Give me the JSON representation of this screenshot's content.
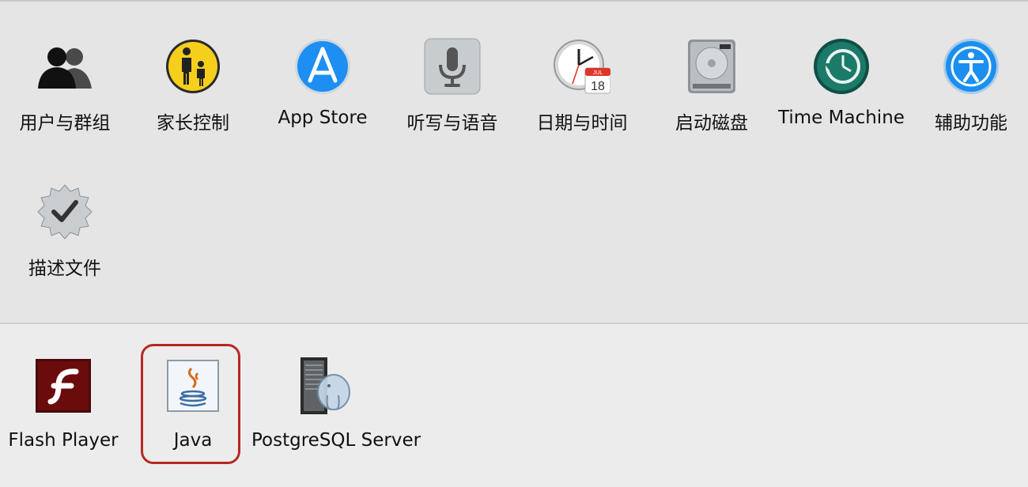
{
  "system_prefs": [
    {
      "label": "用户与群组",
      "icon": "users-groups-icon"
    },
    {
      "label": "家长控制",
      "icon": "parental-controls-icon"
    },
    {
      "label": "App Store",
      "icon": "app-store-icon"
    },
    {
      "label": "听写与语音",
      "icon": "dictation-speech-icon"
    },
    {
      "label": "日期与时间",
      "icon": "date-time-icon"
    },
    {
      "label": "启动磁盘",
      "icon": "startup-disk-icon"
    },
    {
      "label": "Time Machine",
      "icon": "time-machine-icon"
    },
    {
      "label": "辅助功能",
      "icon": "accessibility-icon"
    },
    {
      "label": "描述文件",
      "icon": "profiles-icon"
    }
  ],
  "other_prefs": [
    {
      "label": "Flash Player",
      "icon": "flash-player-icon"
    },
    {
      "label": "Java",
      "icon": "java-icon",
      "highlighted": true
    },
    {
      "label": "PostgreSQL Server",
      "icon": "postgresql-icon"
    }
  ],
  "calendar_icon": {
    "month": "JUL",
    "day": "18"
  },
  "colors": {
    "highlight_border": "#b42a20",
    "pane_background": "#e5e5e5"
  }
}
